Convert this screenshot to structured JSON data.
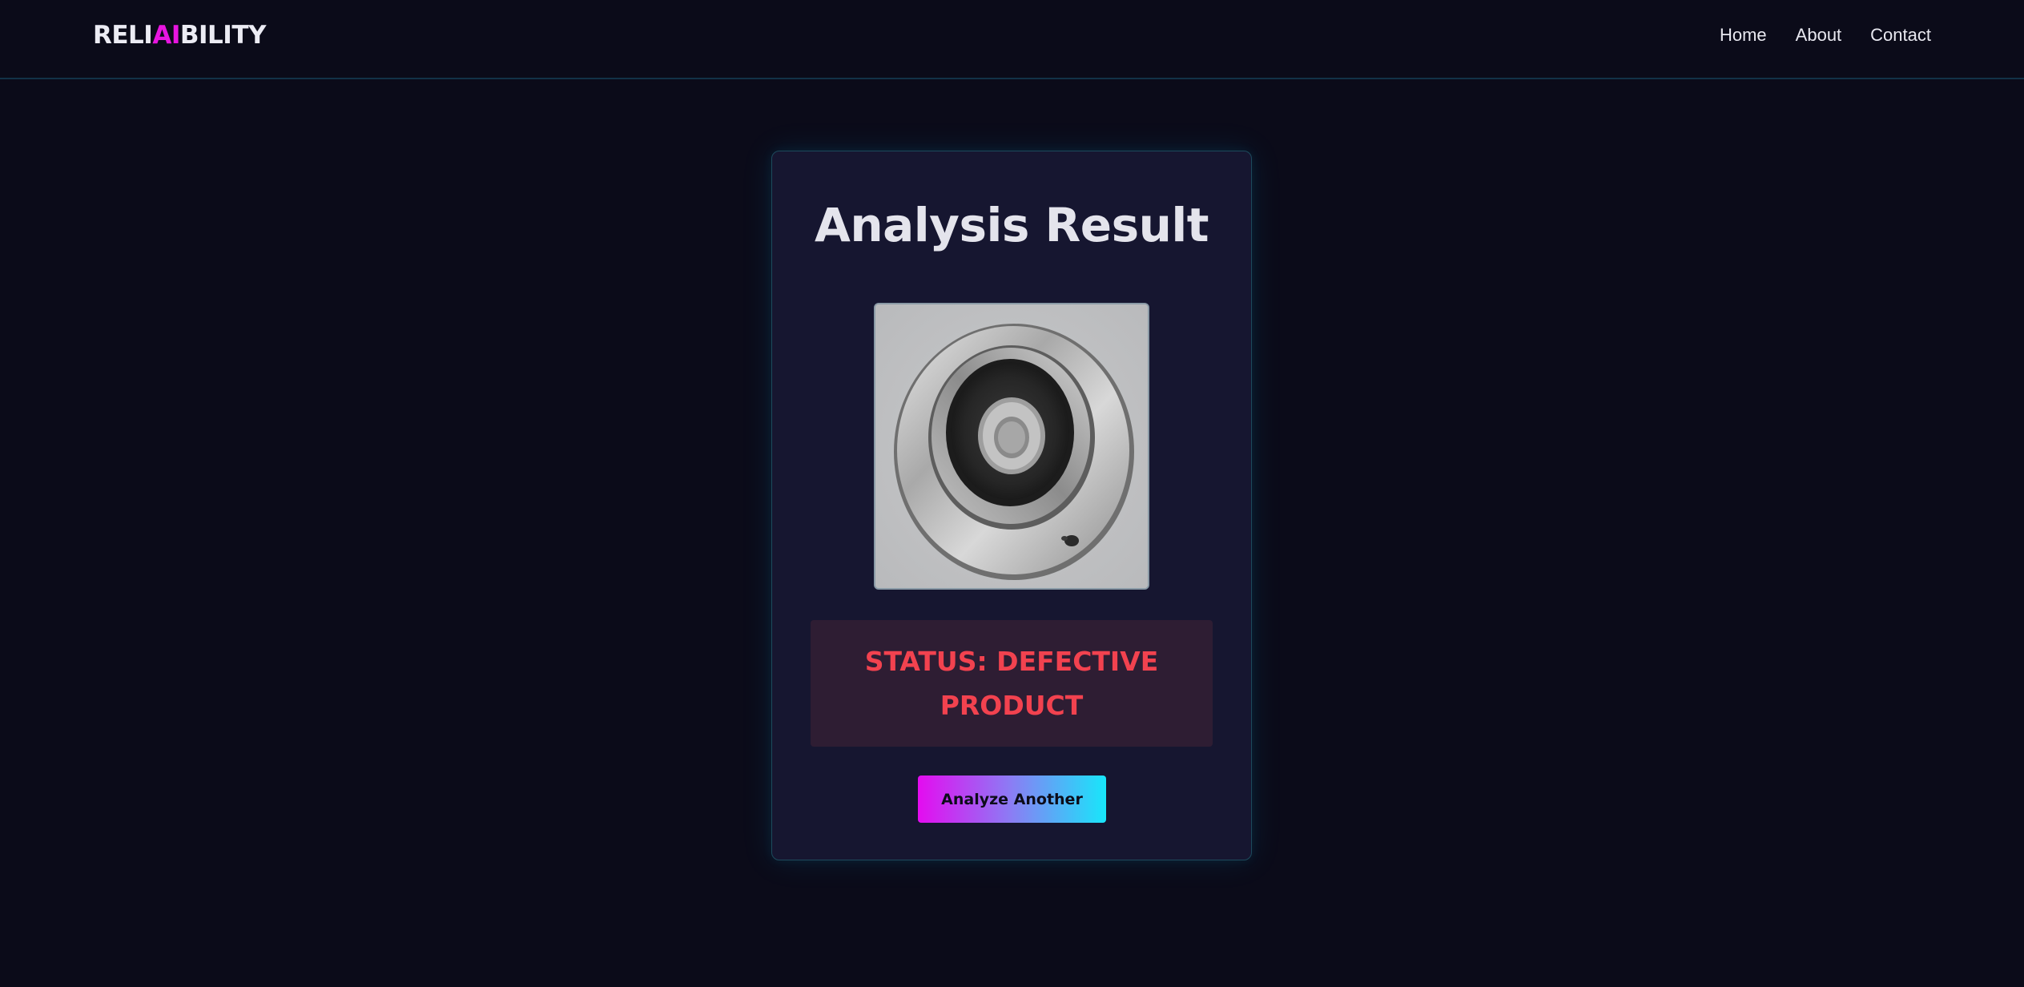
{
  "header": {
    "logo": {
      "prefix": "RELI",
      "highlight": "AI",
      "suffix": "BILITY"
    },
    "nav": [
      {
        "label": "Home"
      },
      {
        "label": "About"
      },
      {
        "label": "Contact"
      }
    ]
  },
  "result": {
    "title": "Analysis Result",
    "status_text": "STATUS: DEFECTIVE PRODUCT",
    "action_label": "Analyze Another"
  },
  "colors": {
    "background": "#0b0b19",
    "card": "#161630",
    "accent_magenta": "#e815e0",
    "accent_cyan": "#18e6fa",
    "status_defective": "#f2424f"
  }
}
